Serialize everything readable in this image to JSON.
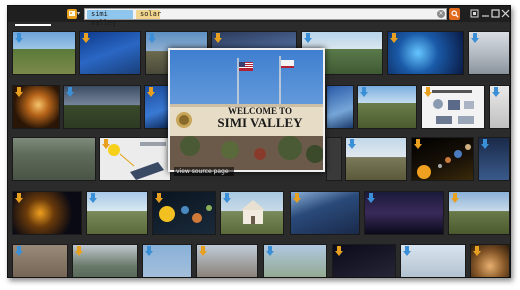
{
  "toolbar": {
    "app_icon": "bing-images-icon",
    "tags": [
      "simi valley",
      "solar"
    ],
    "clear_label": "×",
    "search_icon": "search-icon",
    "window_buttons": [
      "restore-icon",
      "minimize-icon",
      "maximize-icon",
      "close-icon"
    ]
  },
  "featured": {
    "sign_line1": "WELCOME TO",
    "sign_line2": "SIMI VALLEY",
    "link_label": "view source page"
  },
  "colors": {
    "tag_primary": "#8fc6ee",
    "tag_secondary": "#f2d58c",
    "accent": "#e26a1c",
    "badge_blue": "#3b8fd6",
    "badge_orange": "#e8a020"
  }
}
